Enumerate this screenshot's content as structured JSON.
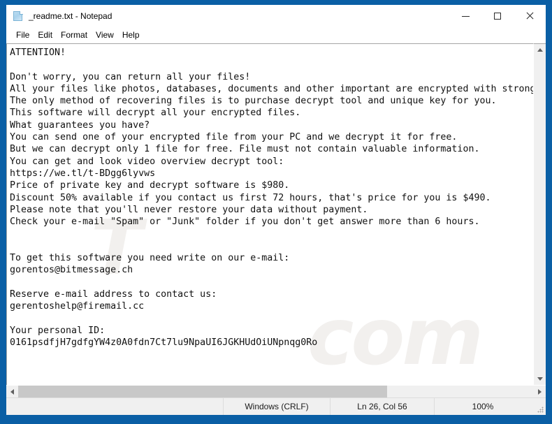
{
  "window": {
    "title": "_readme.txt - Notepad",
    "icon": "text-document-icon",
    "border_color": "#0a5fa5",
    "controls": {
      "minimize_label": "Minimize",
      "maximize_label": "Maximize",
      "close_label": "Close"
    }
  },
  "menubar": {
    "items": [
      {
        "label": "File"
      },
      {
        "label": "Edit"
      },
      {
        "label": "Format"
      },
      {
        "label": "View"
      },
      {
        "label": "Help"
      }
    ]
  },
  "editor": {
    "content": "ATTENTION!\n\nDon't worry, you can return all your files!\nAll your files like photos, databases, documents and other important are encrypted with strongest encryption and unique key.\nThe only method of recovering files is to purchase decrypt tool and unique key for you.\nThis software will decrypt all your encrypted files.\nWhat guarantees you have?\nYou can send one of your encrypted file from your PC and we decrypt it for free.\nBut we can decrypt only 1 file for free. File must not contain valuable information.\nYou can get and look video overview decrypt tool:\nhttps://we.tl/t-BDgg6lyvws\nPrice of private key and decrypt software is $980.\nDiscount 50% available if you contact us first 72 hours, that's price for you is $490.\nPlease note that you'll never restore your data without payment.\nCheck your e-mail \"Spam\" or \"Junk\" folder if you don't get answer more than 6 hours.\n\n\nTo get this software you need write on our e-mail:\ngorentos@bitmessage.ch\n\nReserve e-mail address to contact us:\ngerentoshelp@firemail.cc\n\nYour personal ID:\n0161psdfjH7gdfgYW4z0A0fdn7Ct7lu9NpaUI6JGKHUdOiUNpnqg0Ro",
    "watermark_part1": "T",
    "watermark_part2": "com"
  },
  "statusbar": {
    "line_ending": "Windows (CRLF)",
    "cursor_position": "Ln 26, Col 56",
    "zoom": "100%"
  },
  "scrollbars": {
    "vertical": {
      "up_arrow": "scroll-up",
      "down_arrow": "scroll-down"
    },
    "horizontal": {
      "left_arrow": "scroll-left",
      "right_arrow": "scroll-right",
      "thumb_width_percent": 71.5
    }
  }
}
